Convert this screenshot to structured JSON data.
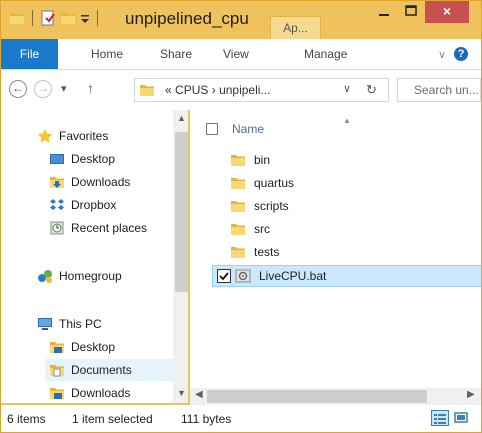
{
  "window": {
    "title": "unpipelined_cpu",
    "context_tab": "Ap...",
    "close_glyph": "×"
  },
  "ribbon": {
    "tabs": [
      "File",
      "Home",
      "Share",
      "View",
      "Manage"
    ],
    "chevron": "∨",
    "help": "?"
  },
  "address_bar": {
    "prefix": "«",
    "crumbs": [
      "CPUS",
      "unpipeli..."
    ],
    "separator": "›",
    "dropdown": "∨",
    "refresh": "↻"
  },
  "search": {
    "placeholder": "Search un..."
  },
  "nav": {
    "back": "←",
    "forward": "→",
    "recent": "▾",
    "up": "↑"
  },
  "nav_pane": {
    "favorites": {
      "label": "Favorites",
      "items": [
        "Desktop",
        "Downloads",
        "Dropbox",
        "Recent places"
      ]
    },
    "homegroup": "Homegroup",
    "this_pc": {
      "label": "This PC",
      "items": [
        "Desktop",
        "Documents",
        "Downloads"
      ]
    }
  },
  "file_list": {
    "column_name": "Name",
    "items": [
      {
        "name": "bin",
        "type": "folder"
      },
      {
        "name": "quartus",
        "type": "folder"
      },
      {
        "name": "scripts",
        "type": "folder"
      },
      {
        "name": "src",
        "type": "folder"
      },
      {
        "name": "tests",
        "type": "folder"
      },
      {
        "name": "LiveCPU.bat",
        "type": "batch",
        "selected": true
      }
    ]
  },
  "status_bar": {
    "item_count": "6 items",
    "selection": "1 item selected",
    "size": "111 bytes"
  },
  "colors": {
    "title_bar": "#f0c25d",
    "file_tab": "#1979ca",
    "close_button": "#c75050",
    "selection": "#cce8ff"
  }
}
